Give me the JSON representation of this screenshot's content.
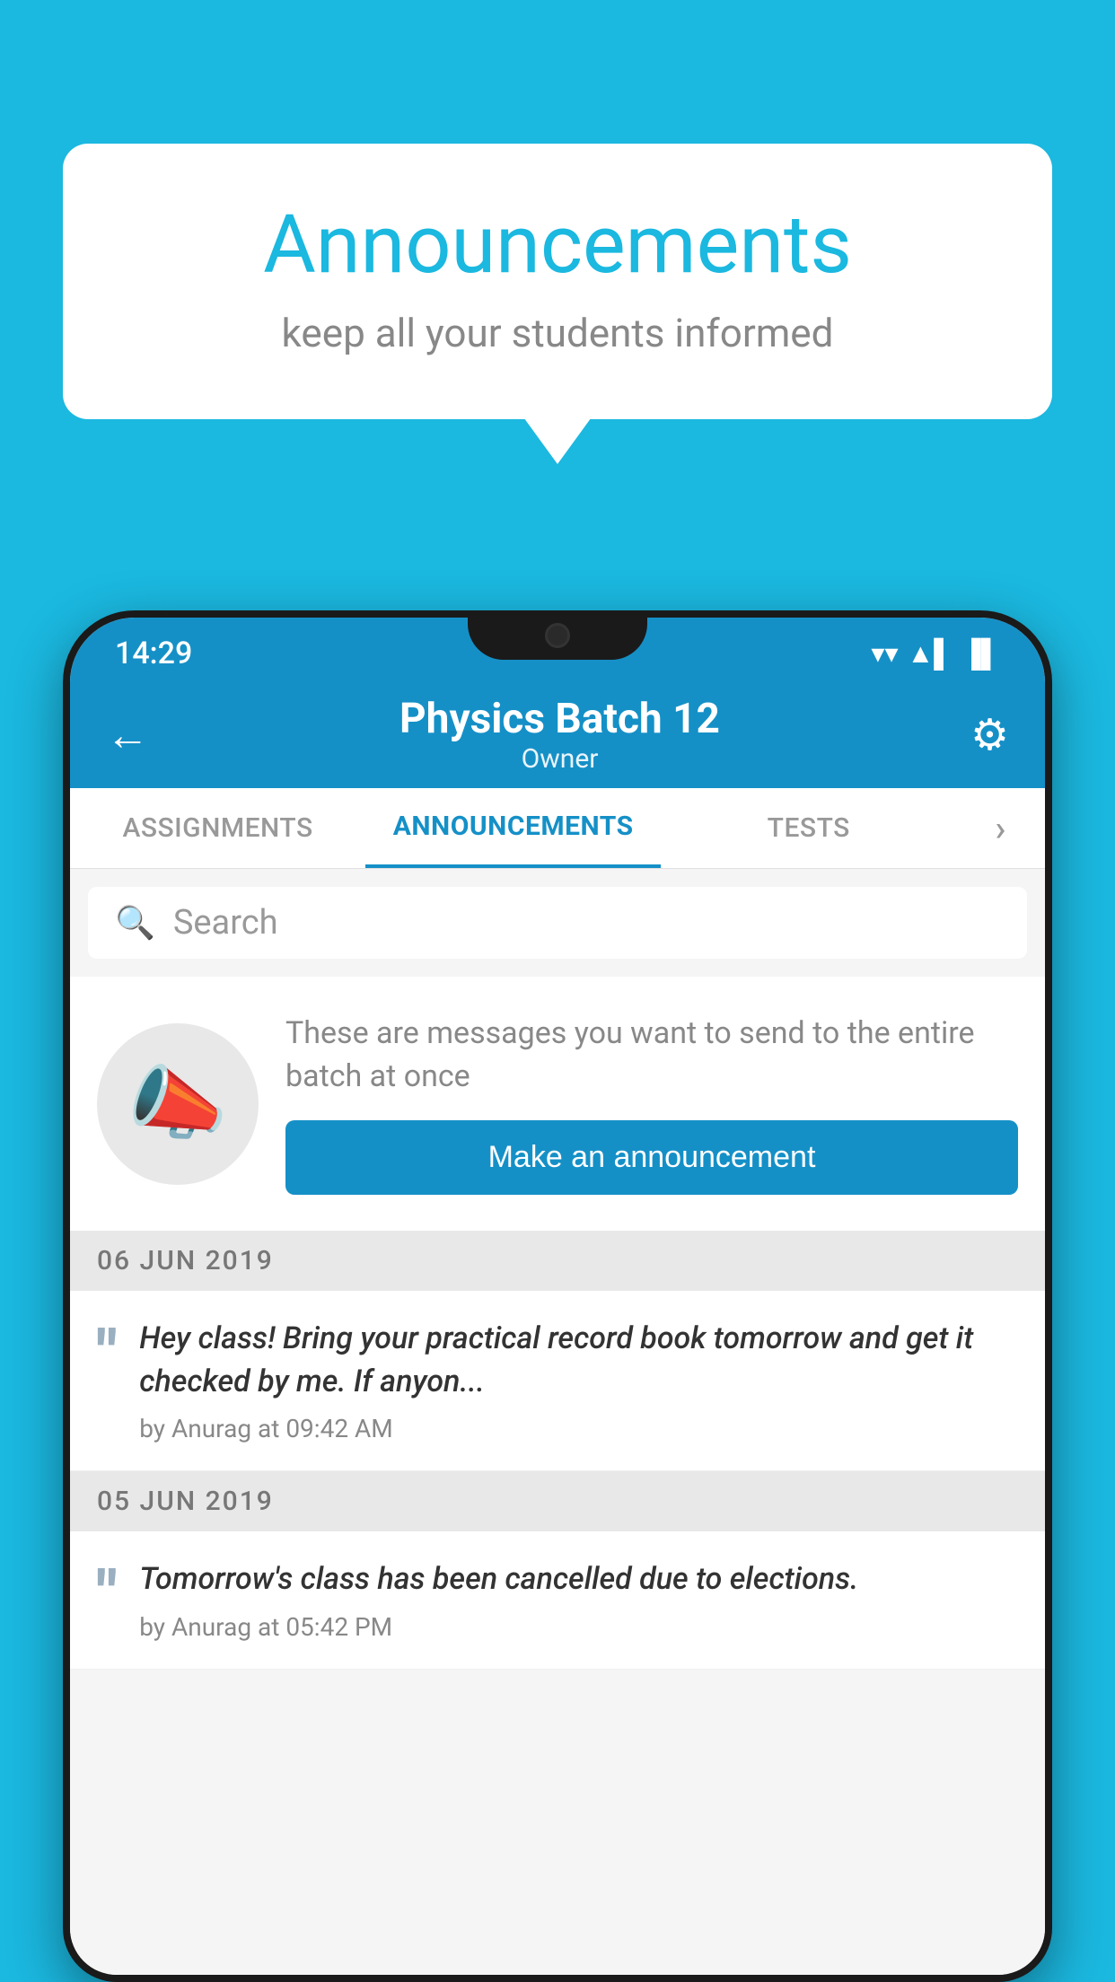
{
  "background_color": "#1bb8e0",
  "speech_bubble": {
    "title": "Announcements",
    "subtitle": "keep all your students informed"
  },
  "phone": {
    "status_bar": {
      "time": "14:29",
      "wifi": "▼",
      "signal": "▲",
      "battery": "▐"
    },
    "header": {
      "back_label": "←",
      "title": "Physics Batch 12",
      "subtitle": "Owner",
      "settings_icon": "⚙"
    },
    "tabs": [
      {
        "label": "ASSIGNMENTS",
        "active": false
      },
      {
        "label": "ANNOUNCEMENTS",
        "active": true
      },
      {
        "label": "TESTS",
        "active": false
      },
      {
        "label": "›",
        "active": false
      }
    ],
    "search": {
      "placeholder": "Search",
      "icon": "🔍"
    },
    "promo": {
      "description": "These are messages you want to send to the entire batch at once",
      "button_label": "Make an announcement"
    },
    "announcements": [
      {
        "date": "06  JUN  2019",
        "text": "Hey class! Bring your practical record book tomorrow and get it checked by me. If anyon...",
        "meta": "by Anurag at 09:42 AM"
      },
      {
        "date": "05  JUN  2019",
        "text": "Tomorrow's class has been cancelled due to elections.",
        "meta": "by Anurag at 05:42 PM"
      }
    ]
  }
}
